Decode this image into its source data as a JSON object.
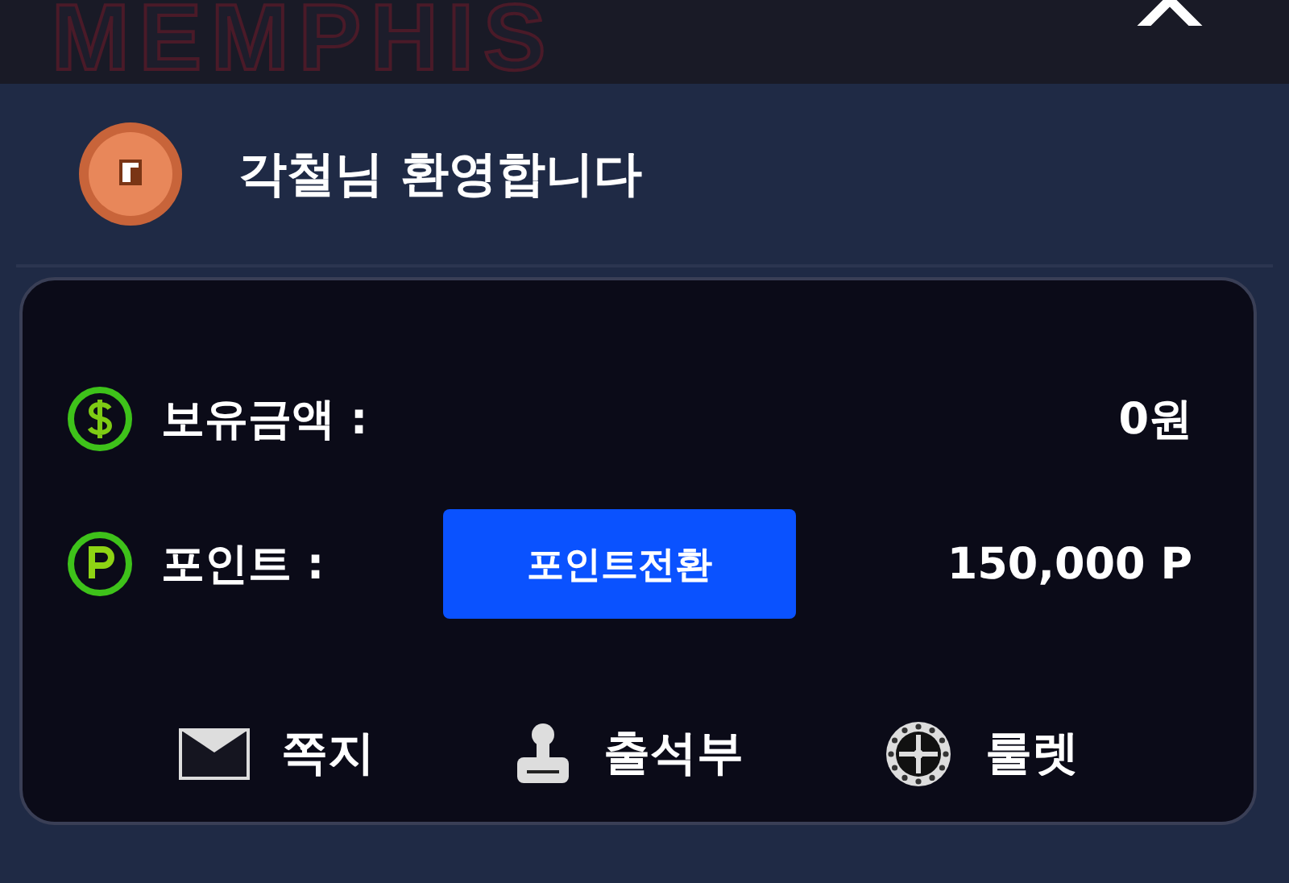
{
  "top_bar": {
    "logo": "MEMPHIS"
  },
  "user": {
    "greeting": "각철님 환영합니다"
  },
  "wallet": {
    "rows": [
      {
        "kind": "money",
        "label": "보유금액 :",
        "value": "0원"
      },
      {
        "kind": "point",
        "label": "포인트 :",
        "button": "포인트전환",
        "value": "150,000 P"
      }
    ]
  },
  "menu": [
    {
      "kind": "message",
      "label": "쪽지"
    },
    {
      "kind": "attendance",
      "label": "출석부"
    },
    {
      "kind": "roulette",
      "label": "룰렛"
    }
  ]
}
